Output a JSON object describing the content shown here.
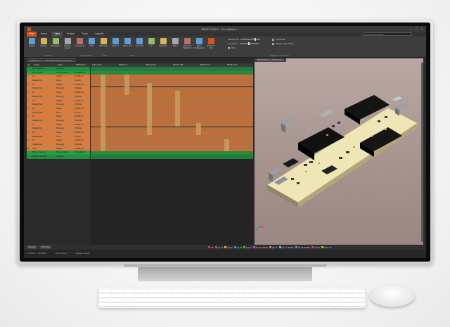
{
  "app": {
    "title": "SMRPLPOHJ - CircuitMaker",
    "tabs": [
      "File",
      "Home",
      "View",
      "Project",
      "Tools",
      "Layouts"
    ],
    "active_tab": "View",
    "search_placeholder": "Type here to search"
  },
  "ribbon": {
    "buttons": [
      {
        "label": "Panels",
        "icon": "panels-icon",
        "color": "#5aa0d8"
      },
      {
        "label": "Project",
        "icon": "project-icon",
        "color": "#d9b35a"
      },
      {
        "label": "Messages",
        "icon": "messages-icon",
        "color": "#8cc06a"
      },
      {
        "label": "Restore Layout",
        "icon": "layout-icon",
        "color": "#a5a5a5"
      },
      {
        "label": "Commands",
        "icon": "commands-icon",
        "color": "#c06a6a"
      },
      {
        "label": "Help",
        "icon": "help-icon",
        "color": "#5aa0d8"
      },
      {
        "label": "Shortcuts",
        "icon": "shortcuts-icon",
        "color": "#d9b35a"
      },
      {
        "label": "Zoom In",
        "icon": "zoom-in-icon",
        "color": "#5aa0d8"
      },
      {
        "label": "Zoom Out",
        "icon": "zoom-out-icon",
        "color": "#5aa0d8"
      },
      {
        "label": "Zoom All",
        "icon": "zoom-all-icon",
        "color": "#5aa0d8"
      },
      {
        "label": "Fit",
        "icon": "fit-icon",
        "color": "#8cc06a"
      },
      {
        "label": "Selection",
        "icon": "selection-icon",
        "color": "#d9b35a"
      },
      {
        "label": "Filter",
        "icon": "filter-icon",
        "color": "#a5a5a5"
      },
      {
        "label": "Nets and Violations",
        "icon": "nets-icon",
        "color": "#c06a6a"
      },
      {
        "label": "View Configuration",
        "icon": "view-config-icon",
        "color": "#5aa0d8"
      },
      {
        "label": "Switch to 2D",
        "icon": "switch-2d-icon",
        "color": "#d9531e"
      }
    ],
    "groups": [
      "System",
      "Collaboration",
      "Help",
      "Zoom",
      "Highlight & Grid mask"
    ],
    "controls": {
      "slider1": "Obstruct off",
      "slider2": "Live Issue",
      "check1": "Fly Board",
      "check2": "Single Layer Mode",
      "check3": "Dim"
    }
  },
  "doc_tabs": {
    "left": "SMRPLPOHJ - PCB-DSP1.PcbDoc [Stackup]",
    "right": "SMRPLPOHJ - PCB.PcbDoc"
  },
  "stack": {
    "headers": [
      "#",
      "Name",
      "Type",
      "Thickness"
    ],
    "rows": [
      {
        "n": "",
        "name": "Top Overlay",
        "type": "Overlay",
        "th": "",
        "color": "#1f8f3c"
      },
      {
        "n": "",
        "name": "Top Solder",
        "type": "Solder Mask",
        "th": "0.01016mm",
        "color": "#2a9b47"
      },
      {
        "n": "1",
        "name": "L1",
        "type": "Signal",
        "th": "0.035mm",
        "color": "#e07a3a"
      },
      {
        "n": "",
        "name": "Dielectric1",
        "type": "Core",
        "th": "0.1mm",
        "color": "#c9814d"
      },
      {
        "n": "2",
        "name": "L2",
        "type": "Signal",
        "th": "0.035mm",
        "color": "#e07a3a"
      },
      {
        "n": "",
        "name": "Dielectric2",
        "type": "Prepreg",
        "th": "0.09mm",
        "color": "#c9814d"
      },
      {
        "n": "3",
        "name": "L3",
        "type": "Plane",
        "th": "0.035mm",
        "color": "#e07a3a"
      },
      {
        "n": "",
        "name": "Dielectric3",
        "type": "Prepreg",
        "th": "0.09mm",
        "color": "#c9814d"
      },
      {
        "n": "4",
        "name": "L4",
        "type": "Signal",
        "th": "0.035mm",
        "color": "#e07a3a"
      },
      {
        "n": "",
        "name": "Dielectric4",
        "type": "Prepreg",
        "th": "0.09mm",
        "color": "#c9814d"
      },
      {
        "n": "5",
        "name": "L5",
        "type": "Plane",
        "th": "0.035mm",
        "color": "#e07a3a"
      },
      {
        "n": "",
        "name": "Dielectric5",
        "type": "Core",
        "th": "0.7mm",
        "color": "#c9814d"
      },
      {
        "n": "6",
        "name": "L6",
        "type": "Plane",
        "th": "0.035mm",
        "color": "#e07a3a"
      },
      {
        "n": "",
        "name": "Dielectric6",
        "type": "Prepreg",
        "th": "0.09mm",
        "color": "#c9814d"
      },
      {
        "n": "7",
        "name": "L7",
        "type": "Signal",
        "th": "0.035mm",
        "color": "#e07a3a"
      },
      {
        "n": "",
        "name": "Dielectric7",
        "type": "Prepreg",
        "th": "0.09mm",
        "color": "#c9814d"
      },
      {
        "n": "8",
        "name": "L8",
        "type": "Plane",
        "th": "0.035mm",
        "color": "#e07a3a"
      },
      {
        "n": "",
        "name": "Dielectric8",
        "type": "Core",
        "th": "0.1mm",
        "color": "#c9814d"
      },
      {
        "n": "9",
        "name": "L9",
        "type": "Signal",
        "th": "0.035mm",
        "color": "#e07a3a"
      },
      {
        "n": "",
        "name": "Dielectric9",
        "type": "Prepreg",
        "th": "0.09mm",
        "color": "#c9814d"
      },
      {
        "n": "10",
        "name": "L10",
        "type": "Signal",
        "th": "0.035mm",
        "color": "#e07a3a"
      },
      {
        "n": "",
        "name": "Bottom Solder",
        "type": "Solder Mask",
        "th": "0.01016mm",
        "color": "#2a9b47"
      },
      {
        "n": "",
        "name": "Bottom Overlay",
        "type": "Overlay",
        "th": "",
        "color": "#1f8f3c"
      }
    ]
  },
  "xsec": {
    "headers": [
      "Thru 1:10",
      "Blind 1:2",
      "Buried 2:9",
      "Buried 3:8",
      "Buried 7:8",
      "Blind 9:10"
    ]
  },
  "statusbar": {
    "buttons": [
      "Stackup",
      "Via Types"
    ],
    "layers": [
      {
        "label": "LS",
        "color": "#d23c3c"
      },
      {
        "label": "[1] L1",
        "color": "#d23c3c"
      },
      {
        "label": "[2] L2",
        "color": "#e0b030"
      },
      {
        "label": "[3] L3",
        "color": "#3c7fd2"
      },
      {
        "label": "[4] L4",
        "color": "#3cb05a"
      },
      {
        "label": "[5] L5 (PWR)",
        "color": "#b04ad2"
      },
      {
        "label": "[6] L6",
        "color": "#d27a3c"
      },
      {
        "label": "[7] L7 (PWR)",
        "color": "#3cc0d2"
      },
      {
        "label": "[8] L8 (PWR)",
        "color": "#7a7ad2"
      },
      {
        "label": "[9] L9",
        "color": "#d23c9a"
      },
      {
        "label": "[10] L10",
        "color": "#8ad23c"
      }
    ]
  },
  "footer": {
    "coords": "X: 39mm Y: 22.55mm",
    "grid": "Grid: 0.5mm",
    "snap": "(Hotspot Snap)"
  }
}
